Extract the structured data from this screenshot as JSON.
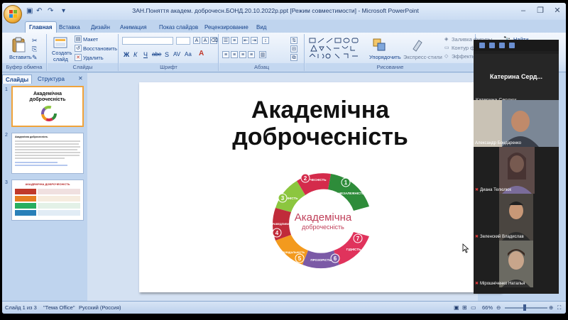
{
  "window": {
    "title": "ЗАН.Поняття академ. доброчесн.БОНД.20.10.2022р.ppt [Режим совместимости] - Microsoft PowerPoint",
    "controls": [
      "–",
      "❐",
      "✕"
    ]
  },
  "ribbon": {
    "tabs": [
      "Главная",
      "Вставка",
      "Дизайн",
      "Анимация",
      "Показ слайдов",
      "Рецензирование",
      "Вид"
    ],
    "clipboard": {
      "paste": "Вставить",
      "label": "Буфер обмена"
    },
    "slides": {
      "new_slide_1": "Создать",
      "new_slide_2": "слайд",
      "layout": "Макет",
      "reset": "Восстановить",
      "delete": "Удалить",
      "label": "Слайды"
    },
    "font": {
      "label": "Шрифт",
      "bold": "Ж",
      "italic": "К",
      "underline": "Ч",
      "strike": "abe",
      "shadow": "S",
      "grow": "A",
      "shrink": "A",
      "case": "Aa"
    },
    "paragraph": {
      "label": "Абзац"
    },
    "drawing": {
      "arrange": "Упорядочить",
      "styles": "Экспресс-стили",
      "fill": "Заливка фигуры",
      "outline": "Контур фи",
      "effects": "Эффекты",
      "label": "Рисование"
    },
    "editing": {
      "find": "Найти"
    }
  },
  "panel": {
    "tabs": [
      "Слайды",
      "Структура"
    ],
    "thumbnails": [
      {
        "num": "1",
        "title": "Академічна доброчесність"
      },
      {
        "num": "2",
        "text": "Академічна доброчесність"
      },
      {
        "num": "3",
        "title": "АКАДЕМІЧНА ДОБРОЧЕСНІСТЬ"
      }
    ]
  },
  "slide": {
    "title_line1": "Академічна",
    "title_line2": "доброчесність",
    "cycle_center_1": "Академічна",
    "cycle_center_2": "доброчесність",
    "cycle_items": [
      {
        "num": "1",
        "label": "НЕЗАЛЕЖНІСТЬ",
        "color": "#2e8c3a"
      },
      {
        "num": "2",
        "label": "ЧЕСНІСТЬ",
        "color": "#d42b4b"
      },
      {
        "num": "3",
        "label": "ТОЧНІСТЬ",
        "color": "#8cc63f"
      },
      {
        "num": "4",
        "label": "СПРАВЕДЛИВІСТЬ",
        "color": "#c02b3a"
      },
      {
        "num": "5",
        "label": "ВІДПОВІДАЛЬНІСТЬ",
        "color": "#f39a1e"
      },
      {
        "num": "6",
        "label": "ПРОЗОРІСТЬ",
        "color": "#7b5aa6"
      },
      {
        "num": "7",
        "label": "ГІДНІСТЬ",
        "color": "#e0335c"
      }
    ]
  },
  "statusbar": {
    "slide_info": "Слайд 1 из 3",
    "theme": "\"Тема Office\"",
    "language": "Русский (Россия)",
    "zoom": "66%"
  },
  "video": {
    "host_name": "Катерина  Серд...",
    "host_small": "Катерина Сердюк",
    "participants": [
      "Александр Бондаренко",
      "Диана Телюлюк",
      "Зеленский Владислав",
      "Мірошніченко Наталья"
    ]
  }
}
